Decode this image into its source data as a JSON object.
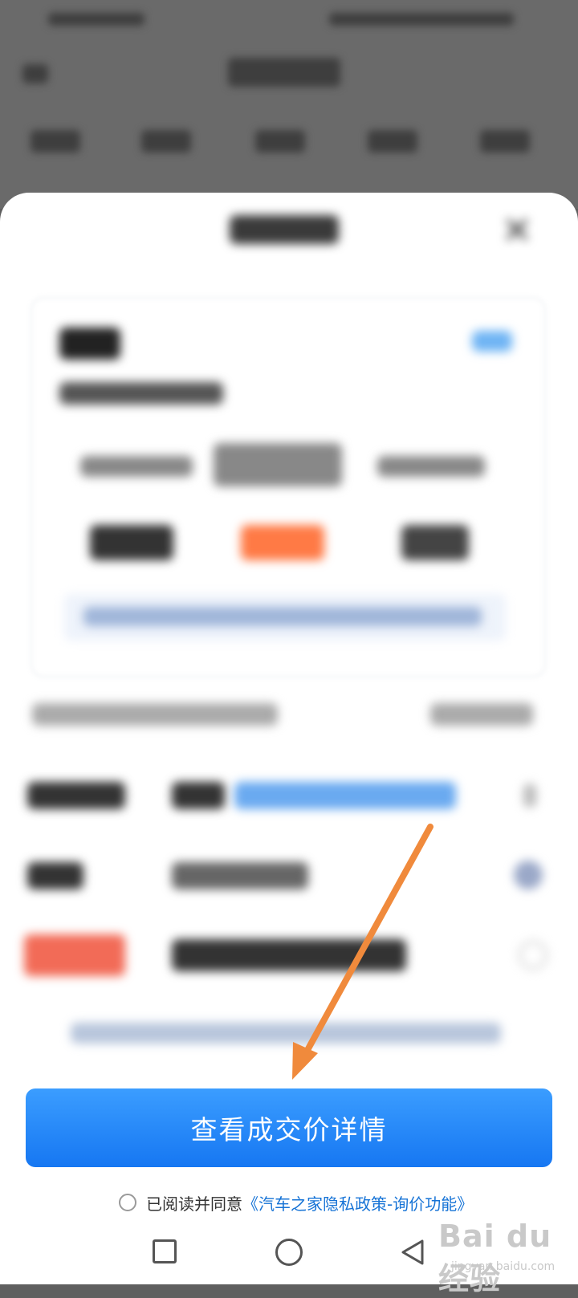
{
  "sheet": {
    "cta_label": "查看成交价详情",
    "agreement_prefix": "已阅读并同意",
    "agreement_link": "《汽车之家隐私政策-询价功能》"
  },
  "watermark": {
    "brand": "Bai du 经验",
    "url": "jingyan.baidu.com"
  },
  "icons": {
    "close": "close-icon",
    "nav_recent": "square-icon",
    "nav_home": "circle-icon",
    "nav_back": "triangle-back-icon"
  },
  "colors": {
    "accent": "#1677f2",
    "link": "#1673d6",
    "arrow": "#f08a3c",
    "tag_red": "#f26b57",
    "price_orange": "#ff7a45"
  }
}
